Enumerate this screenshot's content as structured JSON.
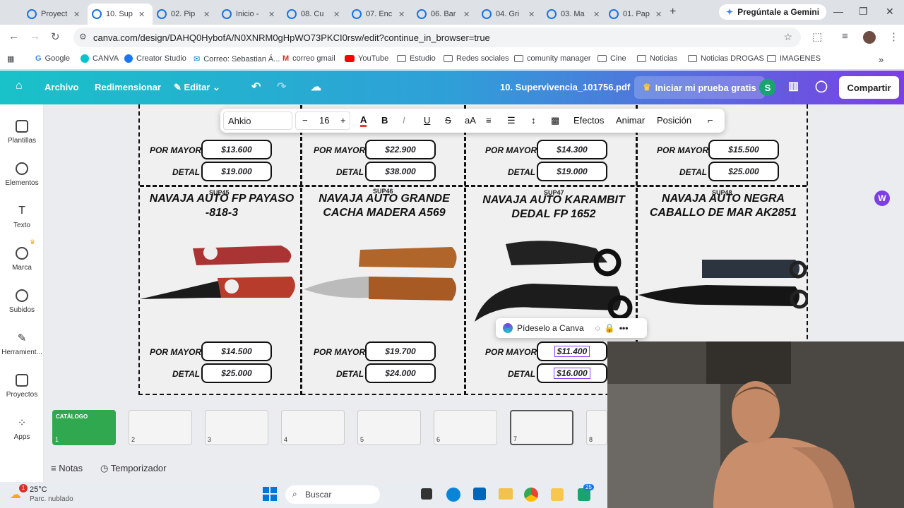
{
  "browser": {
    "tabs": [
      {
        "label": "Proyect"
      },
      {
        "label": "10. Sup",
        "active": true
      },
      {
        "label": "02. Pip"
      },
      {
        "label": "Inicio -"
      },
      {
        "label": "08. Cu"
      },
      {
        "label": "07. Enc"
      },
      {
        "label": "06. Bar"
      },
      {
        "label": "04. Gri"
      },
      {
        "label": "03. Ma"
      },
      {
        "label": "01. Pap"
      }
    ],
    "gemini_label": "Pregúntale a Gemini",
    "url": "canva.com/design/DAHQ0HybofA/N0XNRM0gHpWO73PKCI0rsw/edit?continue_in_browser=true",
    "bookmarks": [
      "Google",
      "CANVA",
      "Creator Studio",
      "Correo: Sebastian Á...",
      "correo gmail",
      "YouTube",
      "Estudio",
      "Redes sociales",
      "comunity manager",
      "Cine",
      "Noticias",
      "Noticias DROGAS",
      "IMAGENES"
    ]
  },
  "canva": {
    "menu": {
      "archivo": "Archivo",
      "redimensionar": "Redimensionar",
      "editar": "Editar"
    },
    "doc_title": "10. Supervivencia_101756.pdf",
    "trial": "Iniciar mi prueba gratis",
    "avatar": "S",
    "share": "Compartir",
    "rail": [
      "Plantillas",
      "Elementos",
      "Texto",
      "Marca",
      "Subidos",
      "Herramient...",
      "Proyectos",
      "Apps"
    ],
    "text_toolbar": {
      "font": "Ahkio",
      "size": "16",
      "effects": "Efectos",
      "animate": "Animar",
      "position": "Posición"
    },
    "ask_canva": "Pídeselo a Canva",
    "footer": {
      "notes": "Notas",
      "timer": "Temporizador"
    },
    "thumbs": [
      "1",
      "2",
      "3",
      "4",
      "5",
      "6",
      "7",
      "8"
    ],
    "thumb1_title": "CATÁLOGO"
  },
  "catalog": {
    "label_mayor": "POR MAYOR",
    "label_detal": "DETAL",
    "top_row": [
      {
        "mayor": "$13.600",
        "detal": "$19.000"
      },
      {
        "mayor": "$22.900",
        "detal": "$38.000"
      },
      {
        "mayor": "$14.300",
        "detal": "$19.000"
      },
      {
        "mayor": "$15.500",
        "detal": "$25.000"
      }
    ],
    "bottom_row": [
      {
        "code": "SUP45",
        "title": "NAVAJA AUTO FP PAYASO -818-3",
        "mayor": "$14.500",
        "detal": "$25.000"
      },
      {
        "code": "SUP46",
        "title": "NAVAJA AUTO GRANDE CACHA MADERA A569",
        "mayor": "$19.700",
        "detal": "$24.000"
      },
      {
        "code": "SUP47",
        "title": "NAVAJA AUTO KARAMBIT DEDAL FP 1652",
        "mayor": "$11.400",
        "detal": "$16.000"
      },
      {
        "code": "SUP48",
        "title": "NAVAJA AUTO NEGRA CABALLO DE MAR AK2851",
        "mayor": "",
        "detal": ""
      }
    ]
  },
  "taskbar": {
    "weather_temp": "25°C",
    "weather_desc": "Parc. nublado",
    "search": "Buscar",
    "badge": "25"
  }
}
